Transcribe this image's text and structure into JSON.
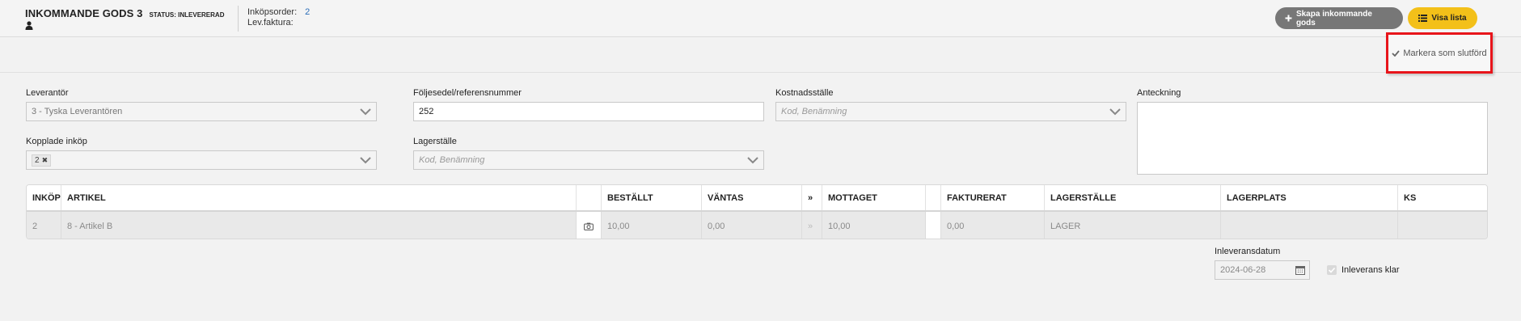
{
  "header": {
    "title": "INKOMMANDE GODS 3",
    "status": "STATUS: INLEVERERAD",
    "purchase_order_label": "Inköpsorder:",
    "purchase_order_value": "2",
    "supplier_invoice_label": "Lev.faktura:",
    "create_button": "Skapa inkommande gods",
    "list_button": "Visa lista",
    "mark_done_button": "Markera som slutförd"
  },
  "form": {
    "supplier_label": "Leverantör",
    "supplier_value": "3 - Tyska Leverantören",
    "linked_purchases_label": "Kopplade inköp",
    "linked_purchases_tag": "2",
    "packing_slip_label": "Följesedel/referensnummer",
    "packing_slip_value": "252",
    "warehouse_label": "Lagerställe",
    "warehouse_placeholder": "Kod, Benämning",
    "cost_center_label": "Kostnadsställe",
    "cost_center_placeholder": "Kod, Benämning",
    "note_label": "Anteckning"
  },
  "table": {
    "headers": [
      "INKÖP",
      "ARTIKEL",
      "",
      "BESTÄLLT",
      "VÄNTAS",
      "»",
      "MOTTAGET",
      "",
      "FAKTURERAT",
      "LAGERSTÄLLE",
      "LAGERPLATS",
      "KS"
    ],
    "row": [
      "2",
      "8 - Artikel B",
      "",
      "10,00",
      "0,00",
      "»",
      "10,00",
      "",
      "0,00",
      "LAGER",
      "",
      ""
    ]
  },
  "footer": {
    "delivery_date_label": "Inleveransdatum",
    "delivery_date_value": "2024-06-28",
    "delivery_done_label": "Inleverans klar"
  }
}
